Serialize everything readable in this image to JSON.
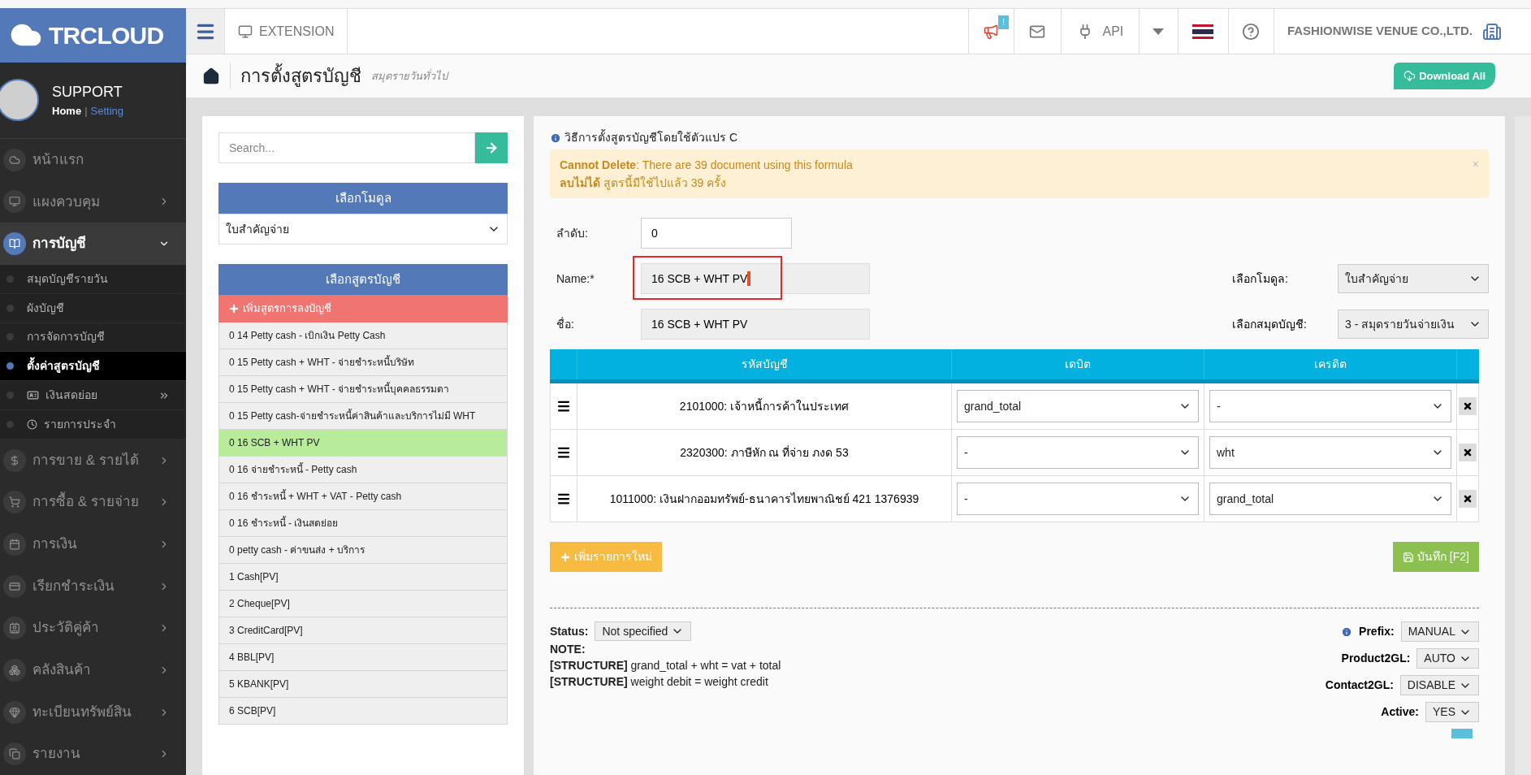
{
  "brand": {
    "name": "TRCLOUD"
  },
  "topbar": {
    "extension": "EXTENSION",
    "notification_badge": "!",
    "api": "API",
    "company": "FASHIONWISE VENUE CO.,LTD."
  },
  "user": {
    "name": "SUPPORT",
    "home": "Home",
    "separator": "|",
    "setting": "Setting"
  },
  "sidebar": {
    "items": [
      {
        "label": "หน้าแรก",
        "kind": "link",
        "selected": false
      },
      {
        "label": "แผงควบคุม",
        "kind": "menu",
        "selected": false,
        "expanded": false
      },
      {
        "label": "การบัญชี",
        "kind": "menu",
        "selected": true,
        "expanded": true,
        "children": [
          {
            "label": "สมุดบัญชีรายวัน",
            "kind": "link",
            "selected": false
          },
          {
            "label": "ผังบัญชี",
            "kind": "link",
            "selected": false
          },
          {
            "label": "การจัดการบัญชี",
            "kind": "link",
            "selected": false
          },
          {
            "label": "ตั้งค่าสูตรบัญชี",
            "kind": "link",
            "selected": true
          },
          {
            "label": "เงินสดย่อย",
            "kind": "submenu",
            "selected": false
          },
          {
            "label": "รายการประจำ",
            "kind": "recurring",
            "selected": false
          }
        ]
      },
      {
        "label": "การขาย & รายได้",
        "kind": "menu",
        "selected": false,
        "expanded": false
      },
      {
        "label": "การซื้อ & รายจ่าย",
        "kind": "menu",
        "selected": false,
        "expanded": false
      },
      {
        "label": "การเงิน",
        "kind": "menu",
        "selected": false,
        "expanded": false
      },
      {
        "label": "เรียกชำระเงิน",
        "kind": "menu",
        "selected": false,
        "expanded": false
      },
      {
        "label": "ประวัติคู่ค้า",
        "kind": "menu",
        "selected": false,
        "expanded": false
      },
      {
        "label": "คลังสินค้า",
        "kind": "menu",
        "selected": false,
        "expanded": false
      },
      {
        "label": "ทะเบียนทรัพย์สิน",
        "kind": "menu",
        "selected": false,
        "expanded": false
      },
      {
        "label": "รายงาน",
        "kind": "menu",
        "selected": false,
        "expanded": false
      }
    ]
  },
  "page_header": {
    "title": "การตั้งสูตรบัญชี",
    "subtitle": "สมุดรายวันทั่วไป",
    "download": "Download All"
  },
  "left_panel": {
    "search": {
      "placeholder": "Search..."
    },
    "module_header": "เลือกโมดูล",
    "module_value": "ใบสำคัญจ่าย",
    "formula_header": "เลือกสูตรบัญชี",
    "add_formula": "เพิ่มสูตรการลงบัญชี",
    "formulas": [
      {
        "label": "0 14 Petty cash - เบิกเงิน Petty Cash",
        "selected": false
      },
      {
        "label": "0 15 Petty cash + WHT - จ่ายชำระหนี้บริษัท",
        "selected": false
      },
      {
        "label": "0 15 Petty cash + WHT - จ่ายชำระหนี้บุคคลธรรมดา",
        "selected": false
      },
      {
        "label": "0 15 Petty cash-จ่ายชำระหนี้ค่าสินค้าและบริการไม่มี WHT",
        "selected": false
      },
      {
        "label": "0 16 SCB + WHT PV",
        "selected": true
      },
      {
        "label": "0 16 จ่ายชำระหนี้ - Petty cash",
        "selected": false
      },
      {
        "label": "0 16 ชำระหนี้ + WHT + VAT - Petty cash",
        "selected": false
      },
      {
        "label": "0 16 ชำระหนี้ - เงินสดย่อย",
        "selected": false
      },
      {
        "label": "0 petty cash - ค่าขนส่ง + บริการ",
        "selected": false
      },
      {
        "label": "1 Cash[PV]",
        "selected": false
      },
      {
        "label": "2 Cheque[PV]",
        "selected": false
      },
      {
        "label": "3 CreditCard[PV]",
        "selected": false
      },
      {
        "label": "4 BBL[PV]",
        "selected": false
      },
      {
        "label": "5 KBANK[PV]",
        "selected": false
      },
      {
        "label": "6 SCB[PV]",
        "selected": false
      }
    ]
  },
  "form": {
    "info": "วิธีการตั้งสูตรบัญชีโดยใช้ตัวแปร C",
    "alert": {
      "lines": [
        "**Cannot Delete**: There are 39 document using this formula",
        "**ลบไม่ได้** สูตรนี้มีใช้ไปแล้ว 39 ครั้ง"
      ],
      "close": "×"
    },
    "order": {
      "label": "ลำดับ:",
      "value": "0"
    },
    "name": {
      "label": "Name:*",
      "value": "16 SCB + WHT PV",
      "highlighted": true
    },
    "thai_name": {
      "label": "ชื่อ:",
      "value": "16 SCB + WHT PV"
    },
    "module": {
      "label": "เลือกโมดูล:",
      "value": "ใบสำคัญจ่าย"
    },
    "journal": {
      "label": "เลือกสมุดบัญชี:",
      "value": "3 - สมุดรายวันจ่ายเงิน"
    }
  },
  "table": {
    "columns": [
      "รหัสบัญชี",
      "เดบิต",
      "เครดิต"
    ],
    "rows": [
      {
        "account": "2101000: เจ้าหนี้การค้าในประเทศ",
        "debit": "grand_total",
        "credit": "-"
      },
      {
        "account": "2320300: ภาษีหัก ณ ที่จ่าย ภงด 53",
        "debit": "-",
        "credit": "wht"
      },
      {
        "account": "1011000: เงินฝากออมทรัพย์-ธนาคารไทยพาณิชย์ 421 1376939",
        "debit": "-",
        "credit": "grand_total"
      }
    ]
  },
  "buttons": {
    "add_row": "เพิ่มรายการใหม่",
    "save": "บันทึก [F2]"
  },
  "footer": {
    "status_label": "Status:",
    "status_value": "Not specified",
    "note": "NOTE:",
    "structure": [
      "**[STRUCTURE]** grand_total + wht = vat + total",
      "**[STRUCTURE]** weight debit = weight credit"
    ],
    "settings": [
      {
        "label": "Prefix:",
        "value": "MANUAL",
        "info": true
      },
      {
        "label": "Product2GL:",
        "value": "AUTO",
        "info": false
      },
      {
        "label": "Contact2GL:",
        "value": "DISABLE",
        "info": false
      },
      {
        "label": "Active:",
        "value": "YES",
        "info": false
      }
    ]
  }
}
